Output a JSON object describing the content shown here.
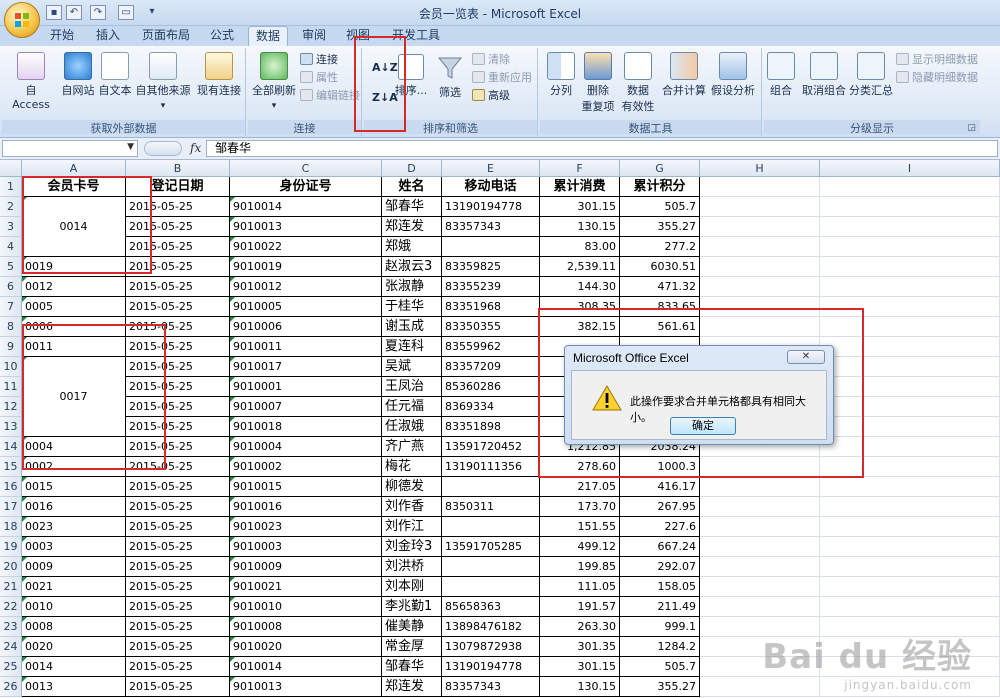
{
  "window": {
    "title": "会员一览表 - Microsoft Excel"
  },
  "tabs": [
    "开始",
    "插入",
    "页面布局",
    "公式",
    "数据",
    "审阅",
    "视图",
    "开发工具"
  ],
  "active_tab": "数据",
  "ribbon": {
    "external_data": {
      "label": "获取外部数据",
      "access": "自 Access",
      "web": "自网站",
      "text": "自文本",
      "other": "自其他来源",
      "existing": "现有连接"
    },
    "connections": {
      "label": "连接",
      "refresh_all": "全部刷新",
      "connections": "连接",
      "properties": "属性",
      "edit_links": "编辑链接"
    },
    "sort_filter": {
      "label": "排序和筛选",
      "sort_az": "A↓Z",
      "sort_za": "Z↓A",
      "sort": "排序...",
      "filter": "筛选",
      "clear": "清除",
      "reapply": "重新应用",
      "advanced": "高级"
    },
    "data_tools": {
      "label": "数据工具",
      "text_to_columns": "分列",
      "remove_dup_1": "删除",
      "remove_dup_2": "重复项",
      "validation_1": "数据",
      "validation_2": "有效性",
      "consolidate": "合并计算",
      "what_if": "假设分析"
    },
    "outline": {
      "label": "分级显示",
      "group": "组合",
      "ungroup": "取消组合",
      "subtotal": "分类汇总",
      "show_detail": "显示明细数据",
      "hide_detail": "隐藏明细数据"
    }
  },
  "formula_bar": {
    "name_box": "",
    "fx": "fx",
    "content": "邹春华"
  },
  "columns": [
    "A",
    "B",
    "C",
    "D",
    "E",
    "F",
    "G",
    "H",
    "I"
  ],
  "table": {
    "headers": [
      "会员卡号",
      "登记日期",
      "身份证号",
      "姓名",
      "移动电话",
      "累计消费",
      "累计积分"
    ],
    "rows": [
      [
        "0014",
        "2015-05-25",
        "9010014",
        "邹春华",
        "13190194778",
        "301.15",
        "505.7"
      ],
      [
        "",
        "2015-05-25",
        "9010013",
        "郑连发",
        "83357343",
        "130.15",
        "355.27"
      ],
      [
        "",
        "2015-05-25",
        "9010022",
        "郑娥",
        "",
        "83.00",
        "277.2"
      ],
      [
        "0019",
        "2015-05-25",
        "9010019",
        "赵淑云3",
        "83359825",
        "2,539.11",
        "6030.51"
      ],
      [
        "0012",
        "2015-05-25",
        "9010012",
        "张淑静",
        "83355239",
        "144.30",
        "471.32"
      ],
      [
        "0005",
        "2015-05-25",
        "9010005",
        "于桂华",
        "83351968",
        "308.35",
        "833.65"
      ],
      [
        "0006",
        "2015-05-25",
        "9010006",
        "谢玉成",
        "83350355",
        "382.15",
        "561.61"
      ],
      [
        "0011",
        "2015-05-25",
        "9010011",
        "夏连科",
        "83559962",
        "",
        ""
      ],
      [
        "0017",
        "2015-05-25",
        "9010017",
        "吴斌",
        "83357209",
        "",
        ""
      ],
      [
        "",
        "2015-05-25",
        "9010001",
        "王凤治",
        "85360286",
        "",
        ""
      ],
      [
        "",
        "2015-05-25",
        "9010007",
        "任元福",
        "8369334",
        "",
        ""
      ],
      [
        "",
        "2015-05-25",
        "9010018",
        "任淑娥",
        "83351898",
        "",
        ""
      ],
      [
        "0004",
        "2015-05-25",
        "9010004",
        "齐广燕",
        "13591720452",
        "1,212.85",
        "2038.24"
      ],
      [
        "0002",
        "2015-05-25",
        "9010002",
        "梅花",
        "13190111356",
        "278.60",
        "1000.3"
      ],
      [
        "0015",
        "2015-05-25",
        "9010015",
        "柳德发",
        "",
        "217.05",
        "416.17"
      ],
      [
        "0016",
        "2015-05-25",
        "9010016",
        "刘作香",
        "8350311",
        "173.70",
        "267.95"
      ],
      [
        "0023",
        "2015-05-25",
        "9010023",
        "刘作江",
        "",
        "151.55",
        "227.6"
      ],
      [
        "0003",
        "2015-05-25",
        "9010003",
        "刘金玲3",
        "13591705285",
        "499.12",
        "667.24"
      ],
      [
        "0009",
        "2015-05-25",
        "9010009",
        "刘洪桥",
        "",
        "199.85",
        "292.07"
      ],
      [
        "0021",
        "2015-05-25",
        "9010021",
        "刘本刚",
        "",
        "111.05",
        "158.05"
      ],
      [
        "0010",
        "2015-05-25",
        "9010010",
        "李兆勤1",
        "85658363",
        "191.57",
        "211.49"
      ],
      [
        "0008",
        "2015-05-25",
        "9010008",
        "催美静",
        "13898476182",
        "263.30",
        "999.1"
      ],
      [
        "0020",
        "2015-05-25",
        "9010020",
        "常金厚",
        "13079872938",
        "301.35",
        "1284.2"
      ],
      [
        "0014",
        "2015-05-25",
        "9010014",
        "邹春华",
        "13190194778",
        "301.15",
        "505.7"
      ],
      [
        "0013",
        "2015-05-25",
        "9010013",
        "郑连发",
        "83357343",
        "130.15",
        "355.27"
      ]
    ]
  },
  "dialog": {
    "title": "Microsoft Office Excel",
    "close": "✕",
    "message": "此操作要求合并单元格都具有相同大小。",
    "ok": "确定"
  },
  "watermark": {
    "logo": "Bai du 经验",
    "url": "jingyan.baidu.com"
  },
  "colors": {
    "annotation_red": "#d42a2a",
    "title_bar": "#c5d9f0"
  }
}
